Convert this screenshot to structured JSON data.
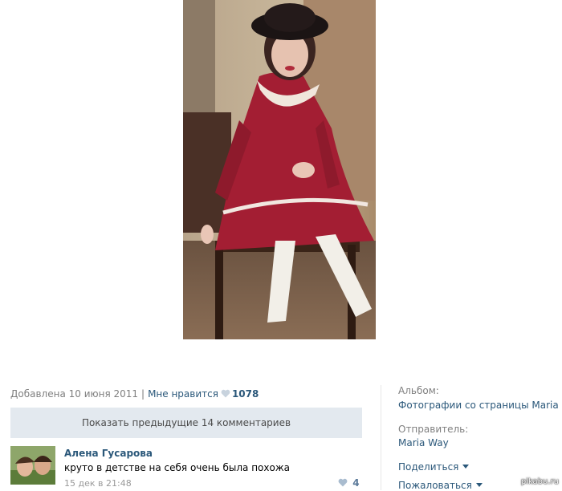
{
  "photo": {
    "alt": "photo"
  },
  "meta": {
    "added": "Добавлена 10 июня 2011",
    "separator": "|",
    "like_label": "Мне нравится",
    "like_count": "1078"
  },
  "comments": {
    "show_previous": "Показать предыдущие 14 комментариев",
    "items": [
      {
        "author": "Алена Гусарова",
        "text": "круто в детстве на себя очень была похожа",
        "time": "15 дек в 21:48",
        "likes": "4"
      }
    ]
  },
  "sidebar": {
    "album_label": "Альбом:",
    "album_value": "Фотографии со страницы Maria",
    "sender_label": "Отправитель:",
    "sender_value": "Maria Way",
    "share": "Поделиться",
    "report": "Пожаловаться"
  },
  "watermark": "pikabu.ru",
  "colors": {
    "link": "#2b587a",
    "button_bg": "#e3e9ef",
    "muted": "#7f7f7f"
  },
  "icons": {
    "like": "heart-icon",
    "dropdown": "chevron-down-icon"
  }
}
